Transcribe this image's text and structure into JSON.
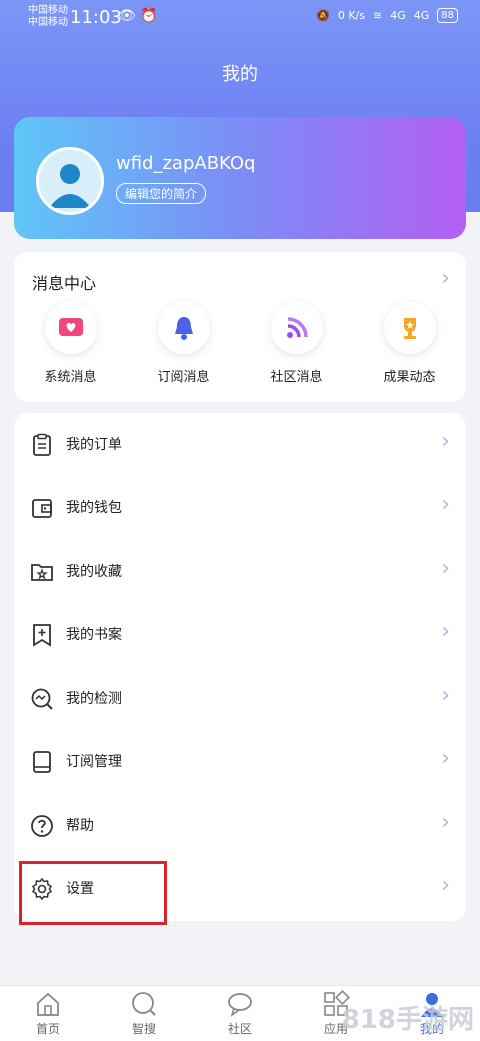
{
  "status_bar": {
    "carrier1": "中国移动",
    "carrier2": "中国移动",
    "time": "11:03",
    "net_speed": "0 K/s",
    "signal1": "4G",
    "signal2": "4G",
    "battery": "88"
  },
  "header": {
    "title": "我的"
  },
  "profile": {
    "username": "wfid_zapABKOq",
    "edit_label": "编辑您的简介"
  },
  "messages": {
    "title": "消息中心",
    "items": [
      {
        "label": "系统消息",
        "icon": "heart-message-icon"
      },
      {
        "label": "订阅消息",
        "icon": "bell-icon"
      },
      {
        "label": "社区消息",
        "icon": "rss-icon"
      },
      {
        "label": "成果动态",
        "icon": "trophy-icon"
      }
    ]
  },
  "menu": [
    {
      "label": "我的订单",
      "icon": "clipboard-icon"
    },
    {
      "label": "我的钱包",
      "icon": "wallet-icon"
    },
    {
      "label": "我的收藏",
      "icon": "folder-star-icon"
    },
    {
      "label": "我的书案",
      "icon": "bookmark-plus-icon"
    },
    {
      "label": "我的检测",
      "icon": "chart-search-icon"
    },
    {
      "label": "订阅管理",
      "icon": "book-icon"
    },
    {
      "label": "帮助",
      "icon": "help-icon"
    },
    {
      "label": "设置",
      "icon": "gear-icon"
    }
  ],
  "tabs": [
    {
      "label": "首页",
      "icon": "home-icon",
      "active": false
    },
    {
      "label": "智搜",
      "icon": "search-icon",
      "active": false
    },
    {
      "label": "社区",
      "icon": "chat-icon",
      "active": false
    },
    {
      "label": "应用",
      "icon": "apps-icon",
      "active": false
    },
    {
      "label": "我的",
      "icon": "user-icon",
      "active": true
    }
  ],
  "watermark": "818手游网",
  "colors": {
    "accent": "#3d6be0",
    "highlight": "#d9232e",
    "header": "#7b96f7"
  }
}
